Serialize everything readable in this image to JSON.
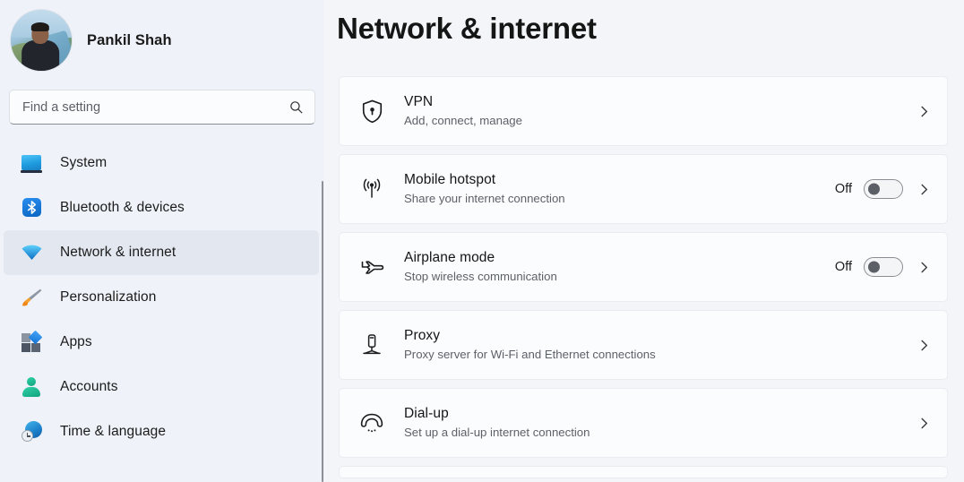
{
  "sidebar": {
    "profile": {
      "name": "Pankil Shah",
      "avatar_icon": "user-avatar-photo"
    },
    "search": {
      "placeholder": "Find a setting",
      "value": "",
      "icon": "search-icon"
    },
    "items": [
      {
        "label": "System",
        "icon": "system-monitor-icon",
        "selected": false
      },
      {
        "label": "Bluetooth & devices",
        "icon": "bluetooth-icon",
        "selected": false
      },
      {
        "label": "Network & internet",
        "icon": "network-wifi-icon",
        "selected": true
      },
      {
        "label": "Personalization",
        "icon": "paintbrush-icon",
        "selected": false
      },
      {
        "label": "Apps",
        "icon": "apps-icon",
        "selected": false
      },
      {
        "label": "Accounts",
        "icon": "account-person-icon",
        "selected": false
      },
      {
        "label": "Time & language",
        "icon": "globe-clock-icon",
        "selected": false
      }
    ],
    "accent_color": "#1f3b8f",
    "background_color": "#eff3f9"
  },
  "main": {
    "title": "Network & internet",
    "cards": [
      {
        "title": "VPN",
        "subtitle": "Add, connect, manage",
        "icon": "shield-lock-icon",
        "has_toggle": false,
        "toggle_state": "",
        "chevron": "chevron-right-icon"
      },
      {
        "title": "Mobile hotspot",
        "subtitle": "Share your internet connection",
        "icon": "hotspot-signal-icon",
        "has_toggle": true,
        "toggle_state": "Off",
        "chevron": "chevron-right-icon"
      },
      {
        "title": "Airplane mode",
        "subtitle": "Stop wireless communication",
        "icon": "airplane-icon",
        "has_toggle": true,
        "toggle_state": "Off",
        "chevron": "chevron-right-icon"
      },
      {
        "title": "Proxy",
        "subtitle": "Proxy server for Wi-Fi and Ethernet connections",
        "icon": "proxy-server-icon",
        "has_toggle": false,
        "toggle_state": "",
        "chevron": "chevron-right-icon"
      },
      {
        "title": "Dial-up",
        "subtitle": "Set up a dial-up internet connection",
        "icon": "dialup-phone-icon",
        "has_toggle": false,
        "toggle_state": "",
        "chevron": "chevron-right-icon"
      }
    ],
    "card_background_color": "#fbfcfe",
    "page_background_color": "#f3f5f9"
  }
}
